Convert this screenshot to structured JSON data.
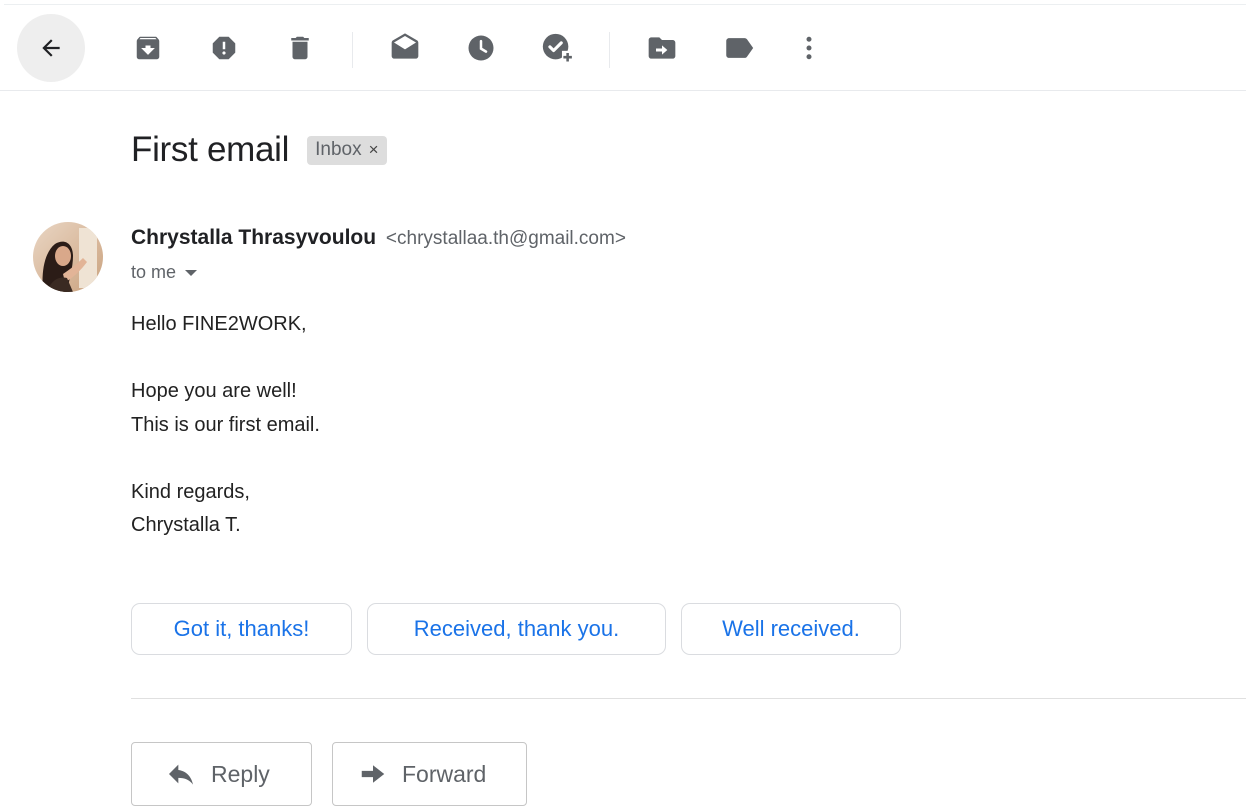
{
  "toolbar": {
    "buttons": [
      {
        "name": "back-button",
        "icon": "arrow-back-icon"
      },
      {
        "name": "archive-button",
        "icon": "archive-icon"
      },
      {
        "name": "report-spam-button",
        "icon": "report-spam-icon"
      },
      {
        "name": "delete-button",
        "icon": "trash-icon"
      },
      {
        "name": "mark-unread-button",
        "icon": "mark-unread-icon"
      },
      {
        "name": "snooze-button",
        "icon": "clock-icon"
      },
      {
        "name": "add-to-tasks-button",
        "icon": "add-task-icon"
      },
      {
        "name": "move-to-button",
        "icon": "move-to-icon"
      },
      {
        "name": "labels-button",
        "icon": "label-icon"
      },
      {
        "name": "more-button",
        "icon": "more-vert-icon"
      }
    ]
  },
  "email": {
    "subject": "First email",
    "label_chip": "Inbox",
    "label_remove": "×",
    "sender_name": "Chrystalla Thrasyvoulou",
    "sender_email": "<chrystallaa.th@gmail.com>",
    "recipient": "to me",
    "body_lines": [
      "Hello FINE2WORK,",
      "",
      "Hope you are well!",
      "This is our first email.",
      "",
      "Kind regards,",
      "Chrystalla T."
    ]
  },
  "smart_replies": [
    "Got it, thanks!",
    "Received, thank you.",
    "Well received."
  ],
  "actions": {
    "reply": "Reply",
    "forward": "Forward"
  },
  "colors": {
    "accent": "#1a73e8",
    "icon": "#5f6368",
    "text": "#202124"
  }
}
